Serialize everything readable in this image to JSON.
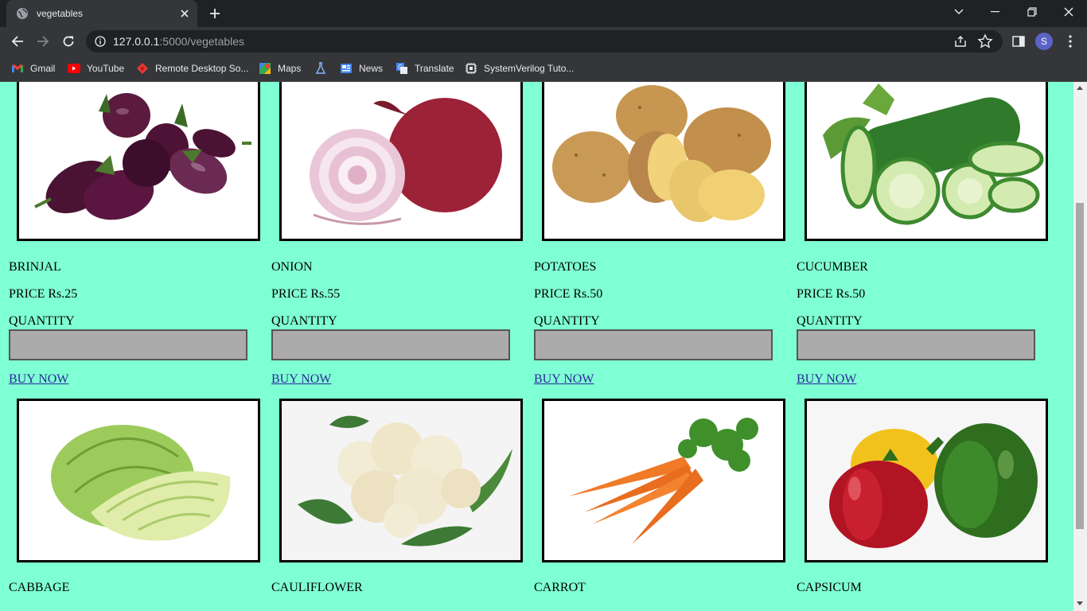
{
  "browser": {
    "tab_title": "vegetables",
    "url_host": "127.0.0.1",
    "url_rest": ":5000/vegetables",
    "profile_initial": "S",
    "bookmarks": [
      {
        "label": "Gmail",
        "icon": "gmail-icon"
      },
      {
        "label": "YouTube",
        "icon": "youtube-icon"
      },
      {
        "label": "Remote Desktop So...",
        "icon": "remote-desktop-icon"
      },
      {
        "label": "Maps",
        "icon": "maps-icon"
      },
      {
        "label": "",
        "icon": "flask-icon"
      },
      {
        "label": "News",
        "icon": "news-icon"
      },
      {
        "label": "Translate",
        "icon": "translate-icon"
      },
      {
        "label": "SystemVerilog Tuto...",
        "icon": "chip-icon"
      }
    ]
  },
  "page": {
    "quantity_label": "QUANTITY",
    "buy_label": "BUY NOW",
    "products": [
      {
        "name": "BRINJAL",
        "price": "PRICE Rs.25",
        "quantity": ""
      },
      {
        "name": "ONION",
        "price": "PRICE Rs.55",
        "quantity": ""
      },
      {
        "name": "POTATOES",
        "price": "PRICE Rs.50",
        "quantity": ""
      },
      {
        "name": "CUCUMBER",
        "price": "PRICE Rs.50",
        "quantity": ""
      },
      {
        "name": "CABBAGE"
      },
      {
        "name": "CAULIFLOWER"
      },
      {
        "name": "CARROT"
      },
      {
        "name": "CAPSICUM"
      }
    ]
  },
  "colors": {
    "page_background": "#7fffd4",
    "input_background": "#ababab",
    "link": "#2a2a9a"
  }
}
